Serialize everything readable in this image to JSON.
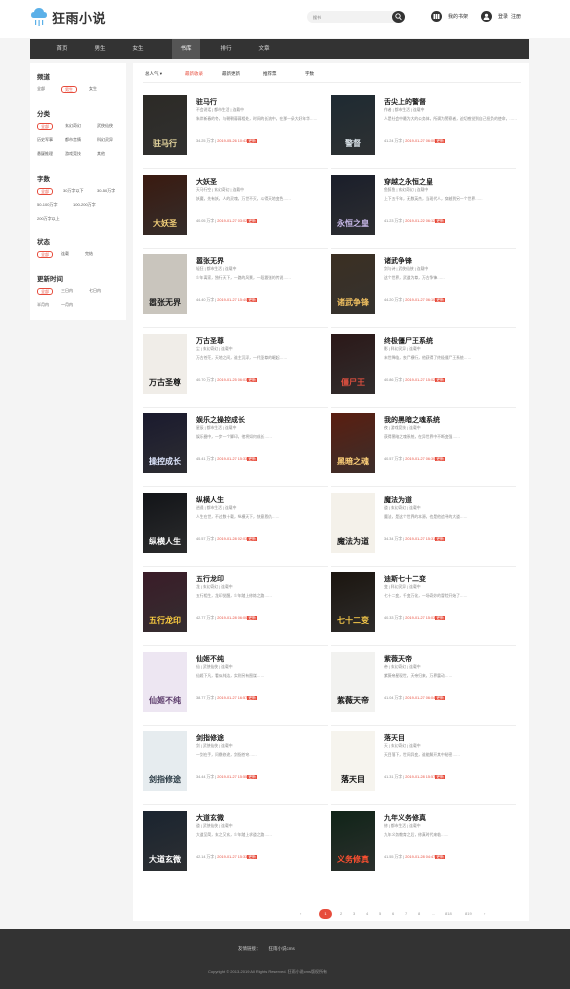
{
  "header": {
    "logo_text": "狂雨小说",
    "search_placeholder": "搜书",
    "shelf_label": "我的书架",
    "login_label": "登录",
    "register_label": "注册"
  },
  "nav": [
    "首页",
    "男生",
    "女生",
    "书库",
    "排行",
    "文章"
  ],
  "nav_active": 3,
  "filters": [
    {
      "title": "频道",
      "options": [
        "全部",
        "男生",
        "女生"
      ],
      "selected": 1
    },
    {
      "title": "分类",
      "options": [
        "全部",
        "玄幻奇幻",
        "武侠仙侠",
        "历史军事",
        "都市言情",
        "科幻灵异",
        "悬疑推理",
        "游戏竞技",
        "其他"
      ],
      "selected": 0
    },
    {
      "title": "字数",
      "options": [
        "全部",
        "30万字以下",
        "30-50万字",
        "50-100万字",
        "100-200万字",
        "200万字以上"
      ],
      "selected": 0
    },
    {
      "title": "状态",
      "options": [
        "全部",
        "连载",
        "完结"
      ],
      "selected": 0
    },
    {
      "title": "更新时间",
      "options": [
        "全部",
        "三日内",
        "七日内",
        "半月内",
        "一月内"
      ],
      "selected": 0
    }
  ],
  "sort_tabs": [
    "总人气",
    "最新收录",
    "最新更新",
    "推荐票",
    "字数"
  ],
  "sort_active": 1,
  "books": [
    {
      "title": "驻马行",
      "meta": "不会说话 | 都市生活 | 连载中",
      "desc": "朱岸新春的冬，与朝朝暮暮相处，时间的长流中，在那一朵大好年华……",
      "words": "34.25 万字",
      "date": "2019-05-26 10:43",
      "cover_bg": "#2c2a26",
      "cover_title": "驻马行",
      "cover_color": "#e8d9a0"
    },
    {
      "title": "舌尖上的警督",
      "meta": "作者 | 都市生活 | 连载中",
      "desc": "人是社会中最为大的公务体，所谓为警察者，迫切感觉到自己担负的使命，……",
      "words": "41.24 万字",
      "date": "2019-01-27 06:00",
      "cover_bg": "#1e2a32",
      "cover_title": "警督",
      "cover_color": "#d7e0e6"
    },
    {
      "title": "大妖圣",
      "meta": "天马行空 | 玄幻奇幻 | 连载中",
      "desc": "妖魔，先有妖，人的灵魂，万世不灭，斗得天地变色……",
      "words": "40.05 万字",
      "date": "2019-01-27 03:02",
      "cover_bg": "#3a1a10",
      "cover_title": "大妖圣",
      "cover_color": "#f3d07a"
    },
    {
      "title": "穿越之永恒之皇",
      "meta": "鱼醉鱼 | 玄幻奇幻 | 连载中",
      "desc": "上下五千年，无数英杰，当现代人，穿越到另一个世界……",
      "words": "41.23 万字",
      "date": "2019-01-22 06:12",
      "cover_bg": "#1a1e2a",
      "cover_title": "永恒之皇",
      "cover_color": "#c8b8e8"
    },
    {
      "title": "嚣张无界",
      "meta": "轻狂 | 都市生活 | 连载中",
      "desc": "少年离家，独行天下，一路的风景，一段嚣张的传说……",
      "words": "44.40 万字",
      "date": "2019-01-27 15:40",
      "cover_bg": "#c9c5bd",
      "cover_title": "嚣张无界",
      "cover_color": "#222222"
    },
    {
      "title": "诸武争锋",
      "meta": "剑与诗 | 武侠仙侠 | 连载中",
      "desc": "这个世界，武道为尊，万古争锋……",
      "words": "44.20 万字",
      "date": "2019-01-27 06:10",
      "cover_bg": "#3b2f22",
      "cover_title": "诸武争锋",
      "cover_color": "#f0c060"
    },
    {
      "title": "万古圣尊",
      "meta": "尘 | 玄幻奇幻 | 连载中",
      "desc": "万古苍茫，天地之间，谁主沉浮，一代圣尊的崛起……",
      "words": "40.70 万字",
      "date": "2019-01-25 06:03",
      "cover_bg": "#f0ede8",
      "cover_title": "万古圣尊",
      "cover_color": "#1a1a1a"
    },
    {
      "title": "终极僵尸王系统",
      "meta": "影 | 科幻灵异 | 连载中",
      "desc": "末世降临，丧尸横行，他获得了终极僵尸王系统……",
      "words": "40.86 万字",
      "date": "2019-01-27 15:02",
      "cover_bg": "#2b1818",
      "cover_title": "僵尸王",
      "cover_color": "#e05040"
    },
    {
      "title": "娱乐之操控成长",
      "meta": "星辰 | 都市生活 | 连载中",
      "desc": "娱乐圈中，一步一个脚印，他将如何成长……",
      "words": "45.41 万字",
      "date": "2019-01-27 15:33",
      "cover_bg": "#1a1a2e",
      "cover_title": "操控成长",
      "cover_color": "#e0e8ff"
    },
    {
      "title": "我的黑暗之魂系统",
      "meta": "夜 | 游戏竞技 | 连载中",
      "desc": "获得黑暗之魂系统，在异世界中不断变强……",
      "words": "40.57 万字",
      "date": "2019-01-27 06:30",
      "cover_bg": "#5a1e10",
      "cover_title": "黑暗之魂",
      "cover_color": "#ffd27a"
    },
    {
      "title": "纵横人生",
      "meta": "逍遥 | 都市生活 | 连载中",
      "desc": "人生在世，不过数十载，纵横天下，快意恩仇……",
      "words": "40.57 万字",
      "date": "2019-01-28 02:03",
      "cover_bg": "#121418",
      "cover_title": "纵横人生",
      "cover_color": "#ffffff"
    },
    {
      "title": "魔法为道",
      "meta": "道 | 玄幻奇幻 | 连载中",
      "desc": "魔法，是这个世界的本源，也是他追寻的大道……",
      "words": "34.34 万字",
      "date": "2019-01-27 15:31",
      "cover_bg": "#f4f1ea",
      "cover_title": "魔法为道",
      "cover_color": "#222222"
    },
    {
      "title": "五行龙印",
      "meta": "龙 | 玄幻奇幻 | 连载中",
      "desc": "五行相生，龙印觉醒，少年踏上修炼之路……",
      "words": "42.77 万字",
      "date": "2019-01-28 06:00",
      "cover_bg": "#3a1c28",
      "cover_title": "五行龙印",
      "cover_color": "#ffd040"
    },
    {
      "title": "迪斯七十二变",
      "meta": "变 | 科幻灵异 | 连载中",
      "desc": "七十二变，千变万化，一场奇妙的冒险开始了……",
      "words": "40.33 万字",
      "date": "2019-01-27 15:03",
      "cover_bg": "#1b150f",
      "cover_title": "七十二变",
      "cover_color": "#f5c84a"
    },
    {
      "title": "仙姬不纯",
      "meta": "仙 | 武侠仙侠 | 连载中",
      "desc": "仙姬下凡，看似纯洁，实则另有图谋……",
      "words": "38.77 万字",
      "date": "2019-01-27 16:57",
      "cover_bg": "#ede6f2",
      "cover_title": "仙姬不纯",
      "cover_color": "#5a3a6a"
    },
    {
      "title": "紫薇天帝",
      "meta": "帝 | 玄幻奇幻 | 连载中",
      "desc": "紫薇帝星现世，天帝归来，万界震动……",
      "words": "41.04 万字",
      "date": "2019-01-27 06:04",
      "cover_bg": "#f2f2f0",
      "cover_title": "紫薇天帝",
      "cover_color": "#1a1a1a"
    },
    {
      "title": "剑指修途",
      "meta": "剑 | 武侠仙侠 | 连载中",
      "desc": "一剑在手，问鼎修途，剑指苍穹……",
      "words": "34.44 万字",
      "date": "2019-01-27 15:55",
      "cover_bg": "#e6ecef",
      "cover_title": "剑指修途",
      "cover_color": "#2a3a44"
    },
    {
      "title": "落天目",
      "meta": "天 | 玄幻奇幻 | 连载中",
      "desc": "天目落下，世间异变，谁能解开其中秘密……",
      "words": "41.31 万字",
      "date": "2019-01-28 15:57",
      "cover_bg": "#f6f4ee",
      "cover_title": "落天目",
      "cover_color": "#111111"
    },
    {
      "title": "大道玄微",
      "meta": "道 | 武侠仙侠 | 连载中",
      "desc": "大道至简，玄之又玄，少年踏上求道之路……",
      "words": "42.14 万字",
      "date": "2019-01-27 15:33",
      "cover_bg": "#1a2430",
      "cover_title": "大道玄微",
      "cover_color": "#ffffff"
    },
    {
      "title": "九年义务修真",
      "meta": "修 | 都市生活 | 连载中",
      "desc": "九年义务教育之后，修真时代来临……",
      "words": "41.55 万字",
      "date": "2019-01-28 04:47",
      "cover_bg": "#102418",
      "cover_title": "义务修真",
      "cover_color": "#ff5030"
    }
  ],
  "update_badge": "更新",
  "pagination": [
    "‹",
    "1",
    "2",
    "3",
    "4",
    "5",
    "6",
    "7",
    "8",
    "...",
    "818",
    "819",
    "›"
  ],
  "pagination_current": 1,
  "footer": {
    "links_label": "友情链接：",
    "link": "狂雨小说cms",
    "copyright": "Copyright © 2013-2019 All Rights Reserved. 狂雨小说cms版权所有"
  }
}
